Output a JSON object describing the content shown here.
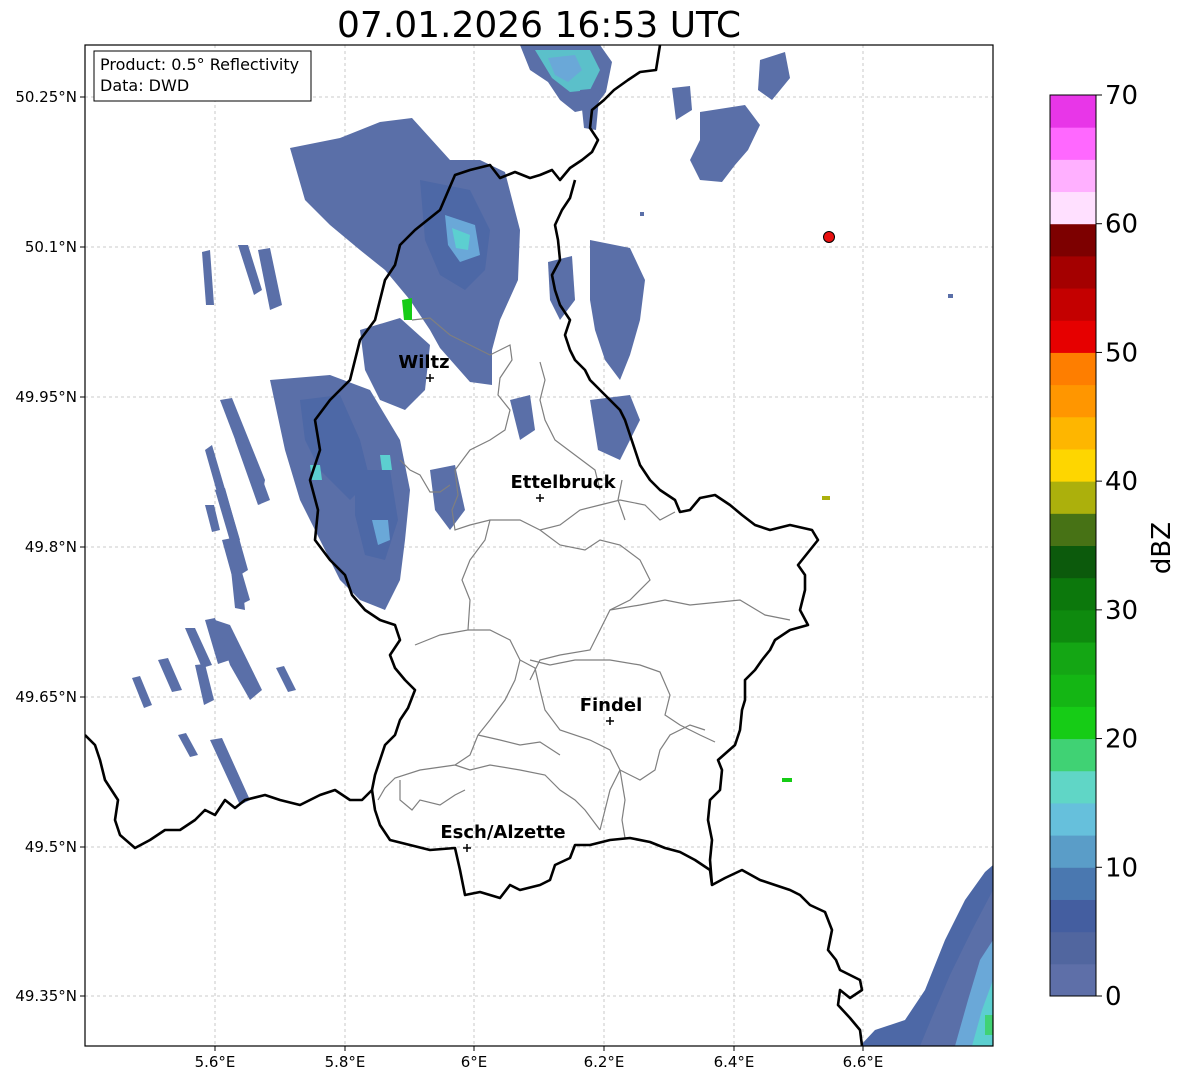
{
  "title": "07.01.2026 16:53 UTC",
  "info_box": {
    "product": "Product: 0.5° Reflectivity",
    "data": "Data: DWD"
  },
  "axes": {
    "lat_ticks": [
      "50.25°N",
      "50.1°N",
      "49.95°N",
      "49.8°N",
      "49.65°N",
      "49.5°N",
      "49.35°N"
    ],
    "lon_ticks": [
      "5.6°E",
      "5.8°E",
      "6°E",
      "6.2°E",
      "6.4°E",
      "6.6°E"
    ]
  },
  "cities": [
    {
      "name": "Wiltz"
    },
    {
      "name": "Ettelbruck"
    },
    {
      "name": "Findel"
    },
    {
      "name": "Esch/Alzette"
    }
  ],
  "colorbar": {
    "label": "dBZ",
    "ticks": [
      "0",
      "10",
      "20",
      "30",
      "40",
      "50",
      "60",
      "70"
    ],
    "colors": [
      "#5e6fa8",
      "#51669f",
      "#445ea0",
      "#4a78b0",
      "#5a9dc8",
      "#66c0dc",
      "#60d6c6",
      "#40d274",
      "#16cc16",
      "#14b614",
      "#14a614",
      "#0e8a0e",
      "#0c780c",
      "#0c5a0c",
      "#477215",
      "#acb00c",
      "#fed600",
      "#feb600",
      "#ff9600",
      "#fe7e00",
      "#e60000",
      "#c40000",
      "#a40000",
      "#7d0000",
      "#ffe0ff",
      "#ffb0ff",
      "#ff68ff",
      "#e836e8"
    ]
  },
  "colors": {
    "radar_light": "#6aa8d8",
    "radar_cyan": "#5ccfd0",
    "border_national": "#000000",
    "border_cantonal": "#7f7f7f",
    "marker_red": "#e81010"
  }
}
